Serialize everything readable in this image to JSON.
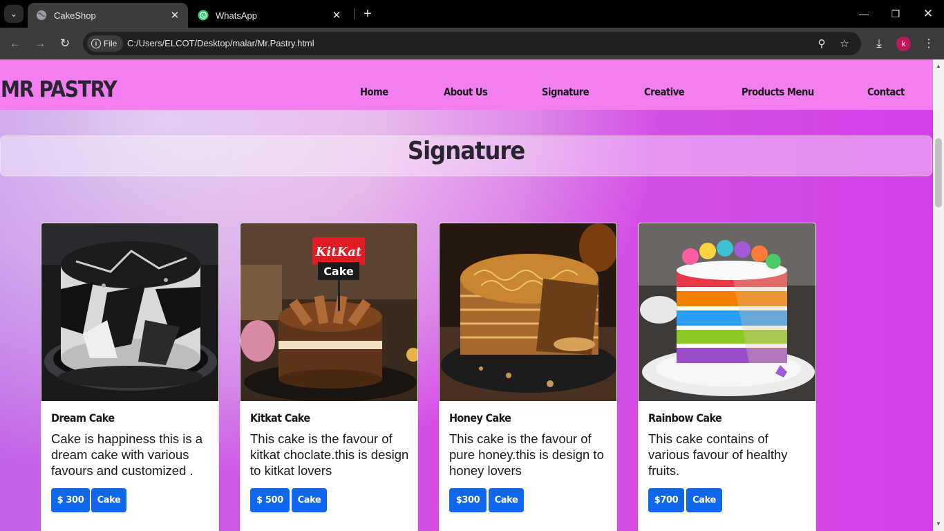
{
  "browser": {
    "tabs": [
      {
        "title": "CakeShop",
        "active": true,
        "favicon": "globe-icon"
      },
      {
        "title": "WhatsApp",
        "active": false,
        "favicon": "whatsapp-icon"
      }
    ],
    "site_chip_label": "File",
    "url": "C:/Users/ELCOT/Desktop/malar/Mr.Pastry.html",
    "profile_initial": "k"
  },
  "site": {
    "brand": "MR PASTRY",
    "nav": [
      "Home",
      "About Us",
      "Signature",
      "Creative",
      "Products Menu",
      "Contact"
    ],
    "section_title": "Signature"
  },
  "cards": [
    {
      "title": "Dream Cake",
      "description": "Cake is happiness this is a dream cake with various favours and customized .",
      "price": "$ 300",
      "tag": "Cake",
      "image": "black-white-geometric-cake"
    },
    {
      "title": "Kitkat Cake",
      "description": "This cake is the favour of kitkat choclate.this is design to kitkat lovers",
      "price": "$ 500",
      "tag": "Cake",
      "image": "kitkat-chocolate-cake",
      "sign_brand": "KitKat",
      "sign_label": "Cake"
    },
    {
      "title": "Honey Cake",
      "description": "This cake is the favour of pure honey.this is design to honey lovers",
      "price": "$300",
      "tag": "Cake",
      "image": "honey-layer-cake"
    },
    {
      "title": "Rainbow Cake",
      "description": "This cake contains of various favour of healthy fruits.",
      "price": "$700",
      "tag": "Cake",
      "image": "rainbow-layer-cake"
    }
  ],
  "colors": {
    "header_bg": "#f27ef0",
    "button_bg": "#1166ee",
    "chrome_bg": "#3c3c3c",
    "page_gradient": [
      "#f2dff2",
      "#d742e8"
    ]
  }
}
